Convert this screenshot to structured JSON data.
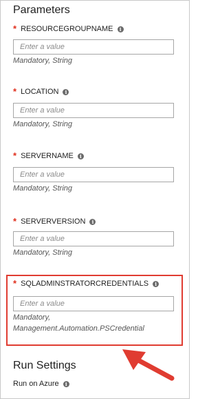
{
  "section_title": "Parameters",
  "field_placeholder": "Enter a value",
  "info_glyph": "i",
  "parameters": [
    {
      "name": "RESOURCEGROUPNAME",
      "required": "*",
      "hint": "Mandatory, String"
    },
    {
      "name": "LOCATION",
      "required": "*",
      "hint": "Mandatory, String"
    },
    {
      "name": "SERVERNAME",
      "required": "*",
      "hint": "Mandatory, String"
    },
    {
      "name": "SERVERVERSION",
      "required": "*",
      "hint": "Mandatory, String"
    },
    {
      "name": "SQLADMINSTRATORCREDENTIALS",
      "required": "*",
      "hint_line1": "Mandatory,",
      "hint_line2": "Management.Automation.PSCredential"
    }
  ],
  "run_settings": {
    "title": "Run Settings",
    "run_on_label": "Run on Azure"
  },
  "colors": {
    "required_star": "#e0301e",
    "highlight_box": "#e03c31",
    "annotation_arrow": "#e03c31"
  },
  "icons": [
    "info-icon",
    "annotation-arrow-icon"
  ]
}
